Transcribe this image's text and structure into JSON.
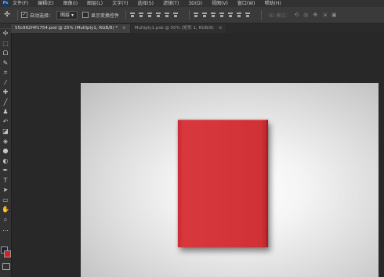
{
  "app": {
    "logo_text": "Ps"
  },
  "menubar": {
    "items": [
      "文件(F)",
      "编辑(E)",
      "图像(I)",
      "图层(L)",
      "文字(Y)",
      "选择(S)",
      "滤镜(T)",
      "3D(D)",
      "视图(V)",
      "窗口(W)",
      "帮助(H)"
    ]
  },
  "options": {
    "move_icon": "✣",
    "auto_select_checked": true,
    "auto_select_label": "自动选择：",
    "layer_select_value": "图层",
    "show_transform_label": "显示变换控件",
    "show_transform_checked": false,
    "mode_3d_label": "3D 模式：",
    "icons_3d": [
      "rotate-3d-icon",
      "roll-3d-icon",
      "pan-3d-icon",
      "slide-3d-icon",
      "scale-3d-icon"
    ]
  },
  "tabs": [
    {
      "label": "55c962f4f1754.psd @ 25% (Multiply1, RGB/8) *",
      "close": "×",
      "active": true
    },
    {
      "label": "Multiply1.psb @ 50% (矩形 1, RGB/8)",
      "close": "×",
      "active": false
    }
  ],
  "toolbar": {
    "tools": [
      {
        "name": "move-tool-icon",
        "glyph": "✣"
      },
      {
        "name": "marquee-tool-icon",
        "glyph": "⬚"
      },
      {
        "name": "lasso-tool-icon",
        "glyph": "ᗝ"
      },
      {
        "name": "quick-select-tool-icon",
        "glyph": "✎"
      },
      {
        "name": "crop-tool-icon",
        "glyph": "⌗"
      },
      {
        "name": "eyedropper-tool-icon",
        "glyph": "⁄"
      },
      {
        "name": "healing-brush-tool-icon",
        "glyph": "✚"
      },
      {
        "name": "brush-tool-icon",
        "glyph": "╱"
      },
      {
        "name": "clone-stamp-tool-icon",
        "glyph": "♟"
      },
      {
        "name": "history-brush-tool-icon",
        "glyph": "↶"
      },
      {
        "name": "eraser-tool-icon",
        "glyph": "◪"
      },
      {
        "name": "paint-bucket-tool-icon",
        "glyph": "◈"
      },
      {
        "name": "blur-tool-icon",
        "glyph": "●"
      },
      {
        "name": "dodge-tool-icon",
        "glyph": "◐"
      },
      {
        "name": "pen-tool-icon",
        "glyph": "✒"
      },
      {
        "name": "type-tool-icon",
        "glyph": "T"
      },
      {
        "name": "path-selection-tool-icon",
        "glyph": "➤"
      },
      {
        "name": "rectangle-tool-icon",
        "glyph": "▭"
      },
      {
        "name": "hand-tool-icon",
        "glyph": "✋"
      },
      {
        "name": "zoom-tool-icon",
        "glyph": "⌕"
      },
      {
        "name": "more-tools-icon",
        "glyph": "…"
      }
    ],
    "foreground_color": "#1b2233",
    "background_color": "#d51f2a"
  },
  "canvas": {
    "book_color": "#d3353a"
  }
}
